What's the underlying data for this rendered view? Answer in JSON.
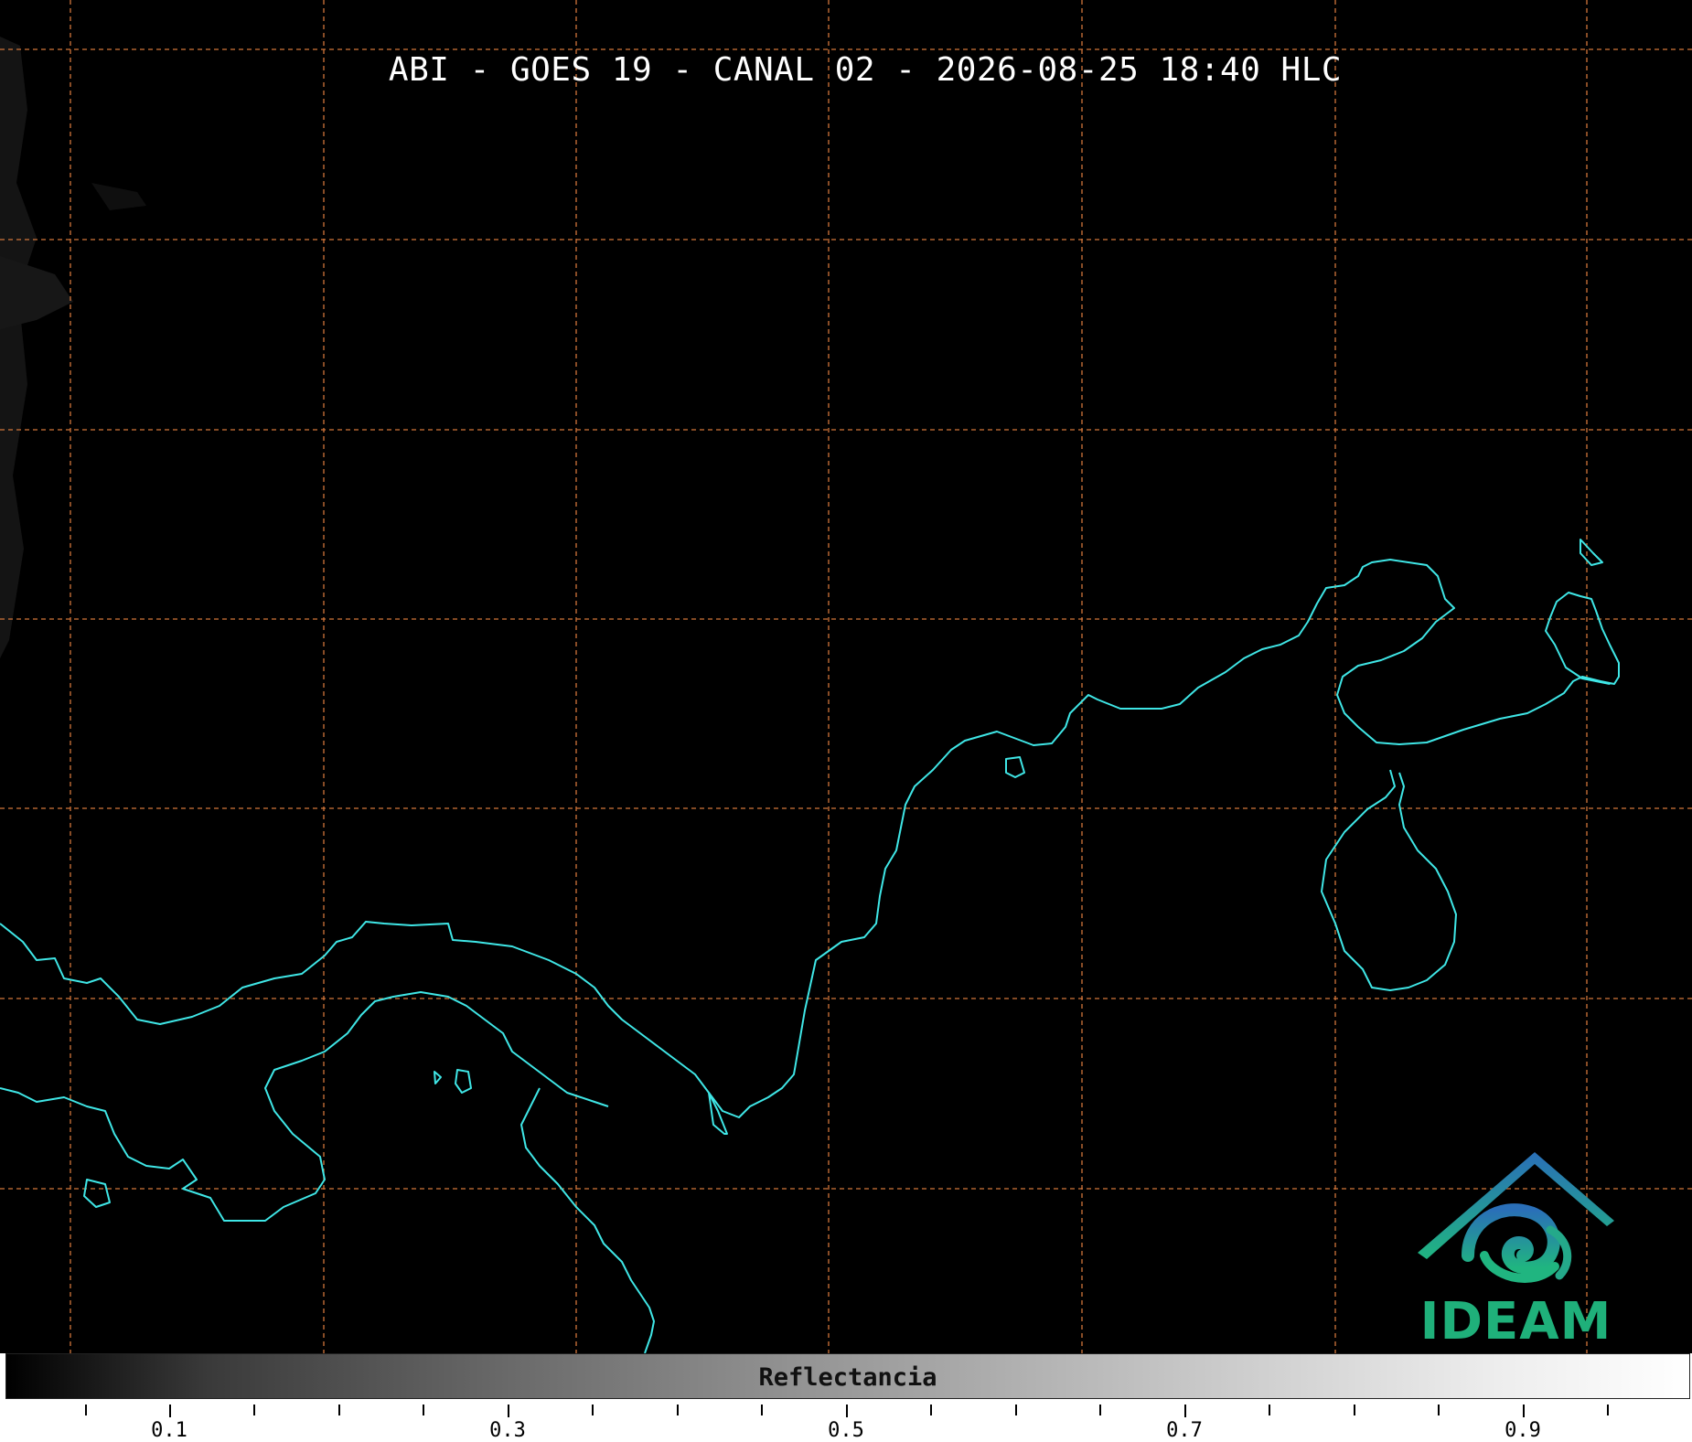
{
  "title": "ABI - GOES 19 - CANAL 02 - 2026-08-25 18:40 HLC",
  "colorbar": {
    "label": "Reflectancia",
    "ticks": [
      "0.1",
      "0.3",
      "0.5",
      "0.7",
      "0.9"
    ]
  },
  "logo": {
    "text": "IDEAM"
  },
  "colors": {
    "background": "#000000",
    "coastline": "#3fe6e6",
    "grid": "#d2763a"
  }
}
